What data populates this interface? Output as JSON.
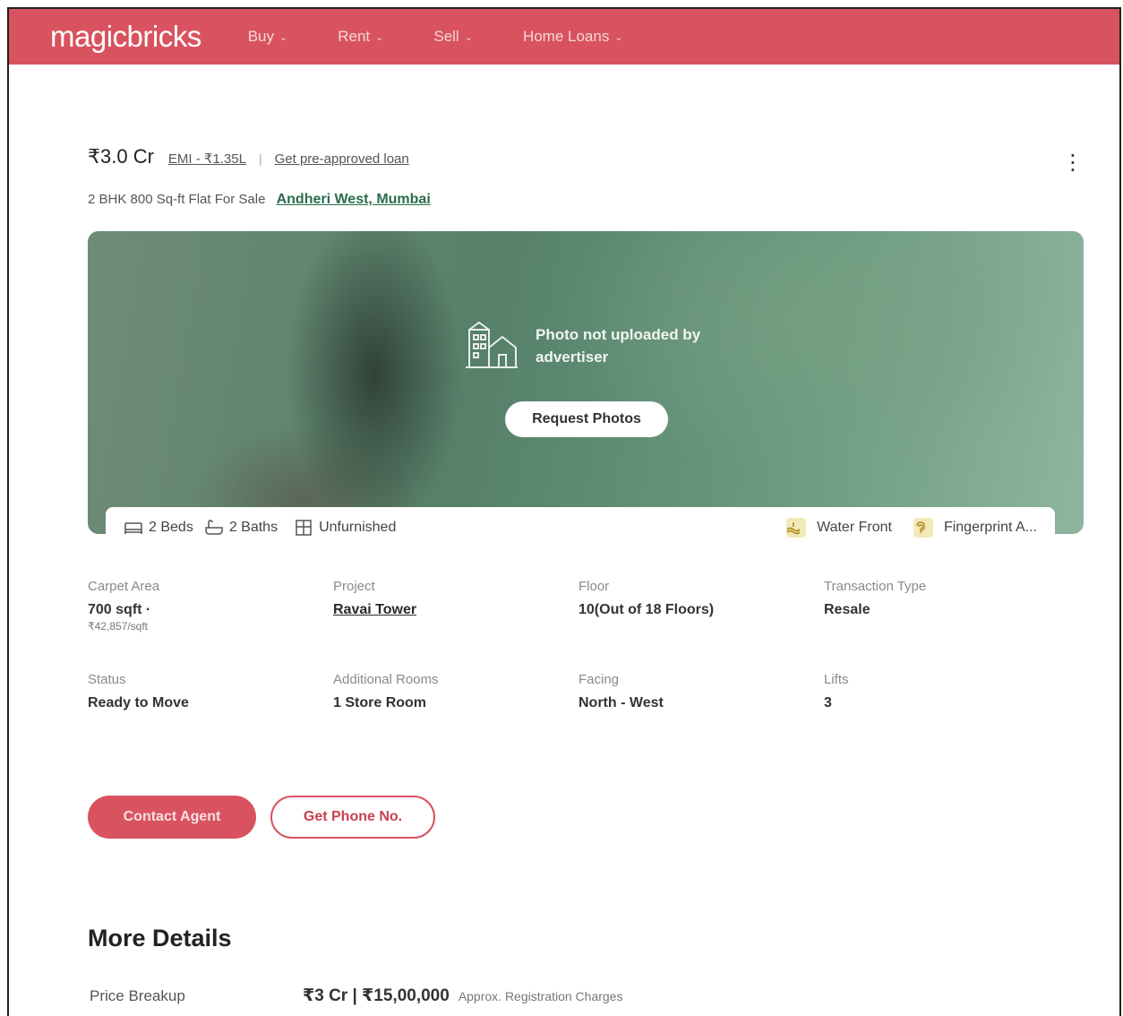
{
  "header": {
    "logo": "magicbricks",
    "nav": [
      {
        "label": "Buy"
      },
      {
        "label": "Rent"
      },
      {
        "label": "Sell"
      },
      {
        "label": "Home Loans"
      }
    ]
  },
  "listing": {
    "price": "₹3.0 Cr",
    "emi": "EMI - ₹1.35L",
    "preapproved": "Get pre-approved loan",
    "title": "2 BHK 800 Sq-ft Flat For Sale",
    "location": "Andheri West, Mumbai"
  },
  "photo": {
    "message": "Photo not uploaded by advertiser",
    "request_label": "Request Photos"
  },
  "amenities": {
    "beds": "2 Beds",
    "baths": "2 Baths",
    "furnishing": "Unfurnished",
    "water_front": "Water Front",
    "fingerprint": "Fingerprint A..."
  },
  "details": {
    "carpet_area": {
      "label": "Carpet Area",
      "value": "700 sqft ·",
      "sub": "₹42,857/sqft"
    },
    "project": {
      "label": "Project",
      "value": "Ravai Tower"
    },
    "floor": {
      "label": "Floor",
      "value": "10(Out of 18 Floors)"
    },
    "transaction": {
      "label": "Transaction Type",
      "value": "Resale"
    },
    "status": {
      "label": "Status",
      "value": "Ready to Move"
    },
    "additional_rooms": {
      "label": "Additional Rooms",
      "value": "1 Store Room"
    },
    "facing": {
      "label": "Facing",
      "value": "North - West"
    },
    "lifts": {
      "label": "Lifts",
      "value": "3"
    }
  },
  "actions": {
    "contact": "Contact Agent",
    "phone": "Get Phone No."
  },
  "more_details": {
    "title": "More Details",
    "price_breakup_label": "Price Breakup",
    "price_breakup_value": "₹3 Cr | ₹15,00,000",
    "price_breakup_note": "Approx. Registration Charges"
  },
  "colors": {
    "brand": "#d8535f",
    "location_link": "#2a6b4a"
  },
  "icons": [
    "chevron-down-icon",
    "more-vertical-icon",
    "building-icon",
    "bed-icon",
    "bath-icon",
    "furniture-icon",
    "water-front-icon",
    "fingerprint-icon"
  ]
}
